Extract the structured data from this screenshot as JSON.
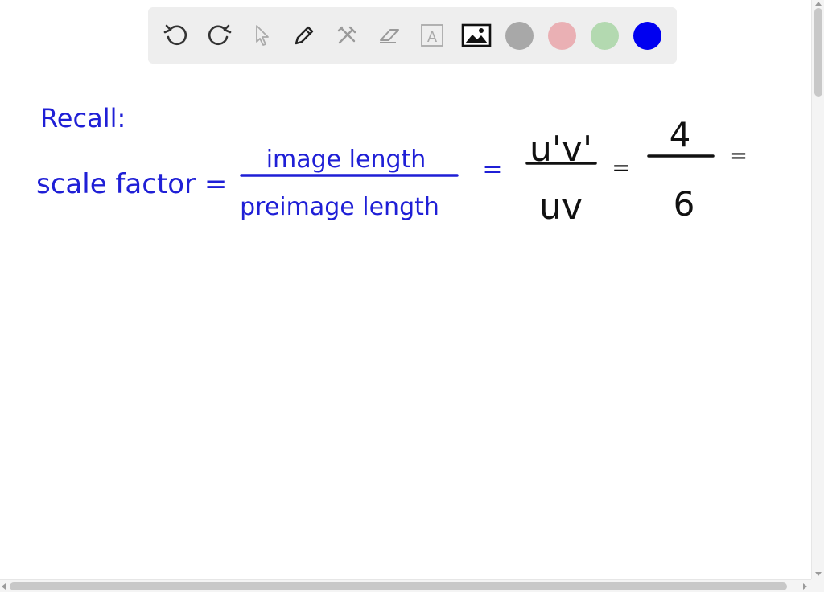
{
  "toolbar": {
    "tools": [
      {
        "name": "undo-icon",
        "label": "Undo"
      },
      {
        "name": "redo-icon",
        "label": "Redo"
      },
      {
        "name": "select-pointer-icon",
        "label": "Select"
      },
      {
        "name": "pen-icon",
        "label": "Pen"
      },
      {
        "name": "tools-icon",
        "label": "Tools"
      },
      {
        "name": "eraser-icon",
        "label": "Eraser"
      },
      {
        "name": "text-icon",
        "label": "A"
      },
      {
        "name": "image-icon",
        "label": "Image"
      }
    ],
    "colors": [
      {
        "name": "gray",
        "hex": "#a8a8a8"
      },
      {
        "name": "pink",
        "hex": "#eab0b4"
      },
      {
        "name": "green",
        "hex": "#b3d9b0"
      },
      {
        "name": "blue",
        "hex": "#0000f0",
        "selected": true
      }
    ]
  },
  "whiteboard": {
    "recall": "Recall:",
    "scale_factor_label": "scale factor =",
    "numerator_words": "image length",
    "denominator_words": "preimage length",
    "eq1": "=",
    "numerator_segment": "u'v'",
    "denominator_segment": "uv",
    "eq2": "=",
    "numerator_value": "4",
    "denominator_value": "6",
    "eq3": "=",
    "ink_blue": "#1f1fd6",
    "ink_black": "#111111"
  }
}
